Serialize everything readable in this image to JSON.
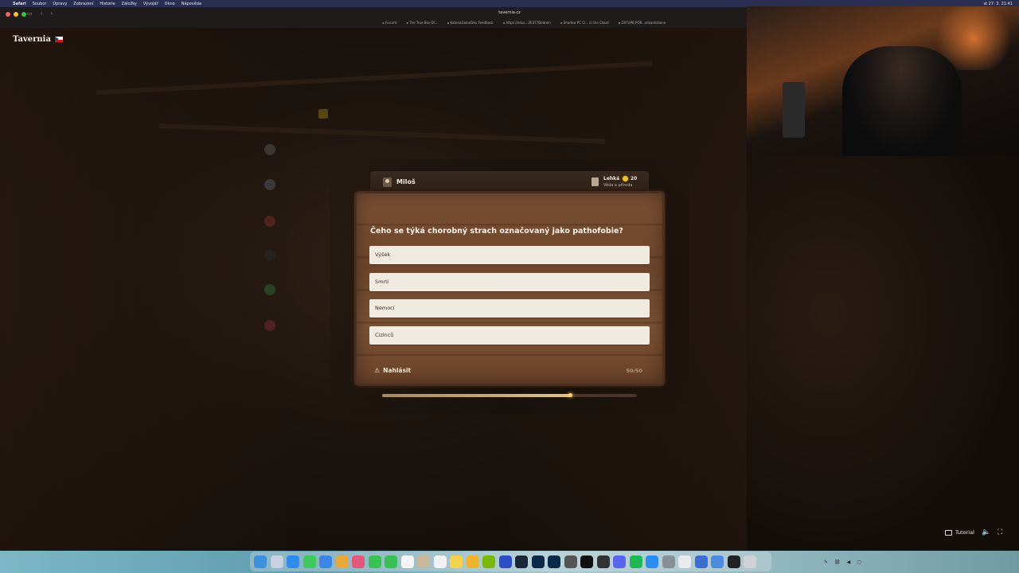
{
  "menubar": {
    "apple": "",
    "items": [
      "Safari",
      "Soubor",
      "Úpravy",
      "Zobrazení",
      "Historie",
      "Záložky",
      "Vývojář",
      "Okno",
      "Nápověda"
    ],
    "clock": "st 27. 3. 21:41"
  },
  "browser": {
    "url": "tavernia.cz",
    "bookmarks": [
      "Forumt",
      "The True Box Of...",
      "KatenaGameDev Feedback",
      "https://educ...2E377Dodnen",
      "Shadow PC Cl... in the Cloud",
      "DXTUPB POR...scbankalaine"
    ]
  },
  "app": {
    "logo": "Tavernia",
    "flag": "cz-flag"
  },
  "quiz": {
    "player_name": "Miloš",
    "difficulty": "Lehká",
    "category": "Věda a příroda",
    "points": "20",
    "question": "Čeho se týká chorobný strach označovaný jako pathofobie?",
    "answers": [
      "Výšek",
      "Smrti",
      "Nemocí",
      "Cizinců"
    ],
    "report_label": "Nahlásit",
    "counter": "50/50",
    "timer_fraction": 0.74
  },
  "overlay": {
    "tutorial_label": "Tutorial"
  },
  "colors": {
    "board": "#7a4f32",
    "answer_bg": "#f0ebe1",
    "progress": "#e2c27a"
  }
}
